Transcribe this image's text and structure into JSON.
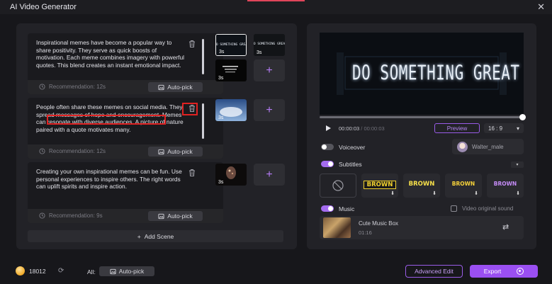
{
  "window": {
    "title": "AI Video Generator",
    "close_glyph": "✕"
  },
  "scenes": [
    {
      "text": "Inspirational memes have become a popular way to share positivity. They serve as quick boosts of motivation. Each meme combines imagery with powerful quotes. This blend creates an instant emotional impact.",
      "recommendation": "Recommendation: 12s",
      "autopick": "Auto-pick",
      "thumbs": [
        {
          "duration": "3s",
          "caption": "DO SOMETHING GREAT"
        },
        {
          "duration": "3s",
          "caption": "DO SOMETHING GREAT"
        },
        {
          "duration": "3s",
          "caption": ""
        }
      ]
    },
    {
      "text": "People often share these memes on social media. They spread messages of hope and encouragement. Memes can resonate with diverse audiences. A picture of nature paired with a quote motivates many.",
      "recommendation": "Recommendation: 12s",
      "autopick": "Auto-pick",
      "thumbs": [
        {
          "duration": "3s",
          "caption": ""
        }
      ]
    },
    {
      "text": "Creating your own inspirational memes can be fun. Use personal experiences to inspire others. The right words can uplift spirits and inspire action.",
      "recommendation": "Recommendation: 9s",
      "autopick": "Auto-pick",
      "thumbs": [
        {
          "duration": "3s",
          "caption": ""
        }
      ]
    }
  ],
  "add_scene": "Add Scene",
  "preview": {
    "overlay_text": "DO SOMETHING GREAT",
    "current_time": "00:00:03",
    "total_time": "/ 00:00:03",
    "progress": 1.0,
    "preview_button": "Preview",
    "ratio": "16 : 9"
  },
  "voiceover": {
    "label": "Voiceover",
    "enabled": false,
    "voice": "Walter_male"
  },
  "subtitles": {
    "label": "Subtitles",
    "enabled": true,
    "styles": [
      {
        "word": "BROWN",
        "color": "#f2d22e",
        "bg": "#1a1a1a"
      },
      {
        "word": "BROWN",
        "color": "#f7e04a",
        "bg": "#2a2a2f"
      },
      {
        "word": "BROWN",
        "color": "#f6d23a",
        "bg": "#2a2a2f"
      },
      {
        "word": "BROWN",
        "color": "#c58cf7",
        "bg": "#2a2a2f"
      }
    ]
  },
  "music": {
    "label": "Music",
    "enabled": true,
    "original_sound_label": "Video original sound",
    "track_name": "Cute Music Box",
    "track_duration": "01:16"
  },
  "footer": {
    "credits": "18012",
    "all_label": "All:",
    "all_autopick": "Auto-pick",
    "advanced_edit": "Advanced Edit",
    "export": "Export"
  },
  "colors": {
    "accent": "#9a4ff2",
    "highlight": "#e02222"
  }
}
